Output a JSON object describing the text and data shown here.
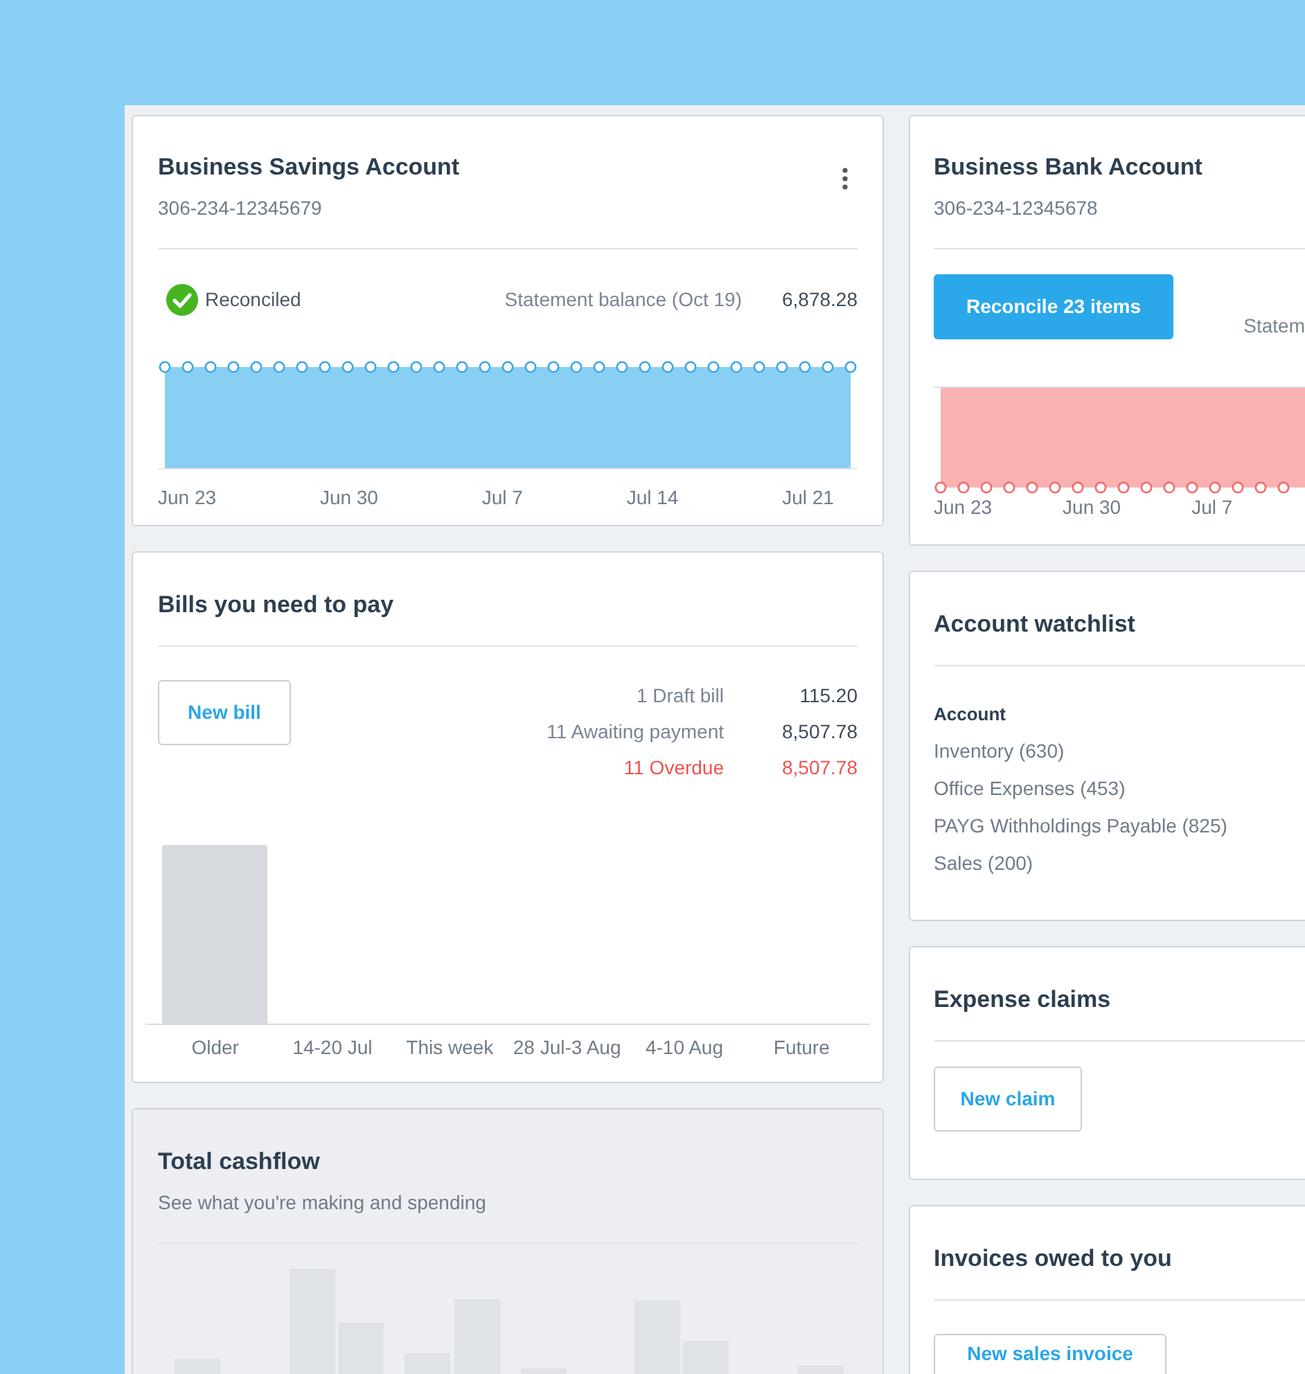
{
  "savings_account": {
    "title": "Business Savings Account",
    "account_number": "306-234-12345679",
    "reconciled": true,
    "status": "Reconciled",
    "balance_label": "Statement balance (Oct 19)",
    "balance": "6,878.28",
    "x_labels": [
      "Jun 23",
      "Jun 30",
      "Jul 7",
      "Jul 14",
      "Jul 21"
    ]
  },
  "bills": {
    "title": "Bills you need to pay",
    "new_button": "New bill",
    "summary": [
      {
        "label": "1 Draft bill",
        "amount": "115.20",
        "overdue": false
      },
      {
        "label": "11 Awaiting payment",
        "amount": "8,507.78",
        "overdue": false
      },
      {
        "label": "11 Overdue",
        "amount": "8,507.78",
        "overdue": true
      }
    ],
    "categories": [
      "Older",
      "14-20 Jul",
      "This week",
      "28 Jul-3 Aug",
      "4-10 Aug",
      "Future"
    ]
  },
  "cashflow": {
    "title": "Total cashflow",
    "subtitle": "See what you're making and spending"
  },
  "bank_account": {
    "title": "Business Bank Account",
    "account_number": "306-234-12345678",
    "reconcile_button": "Reconcile 23 items",
    "balance_label": "Statem",
    "x_labels": [
      "Jun 23",
      "Jun 30",
      "Jul 7"
    ]
  },
  "watchlist": {
    "title": "Account watchlist",
    "column": "Account",
    "accounts": [
      "Inventory (630)",
      "Office Expenses (453)",
      "PAYG Withholdings Payable (825)",
      "Sales (200)"
    ]
  },
  "expense_claims": {
    "title": "Expense claims",
    "new_button": "New claim"
  },
  "invoices": {
    "title": "Invoices owed to you",
    "new_button": "New sales invoice"
  }
}
